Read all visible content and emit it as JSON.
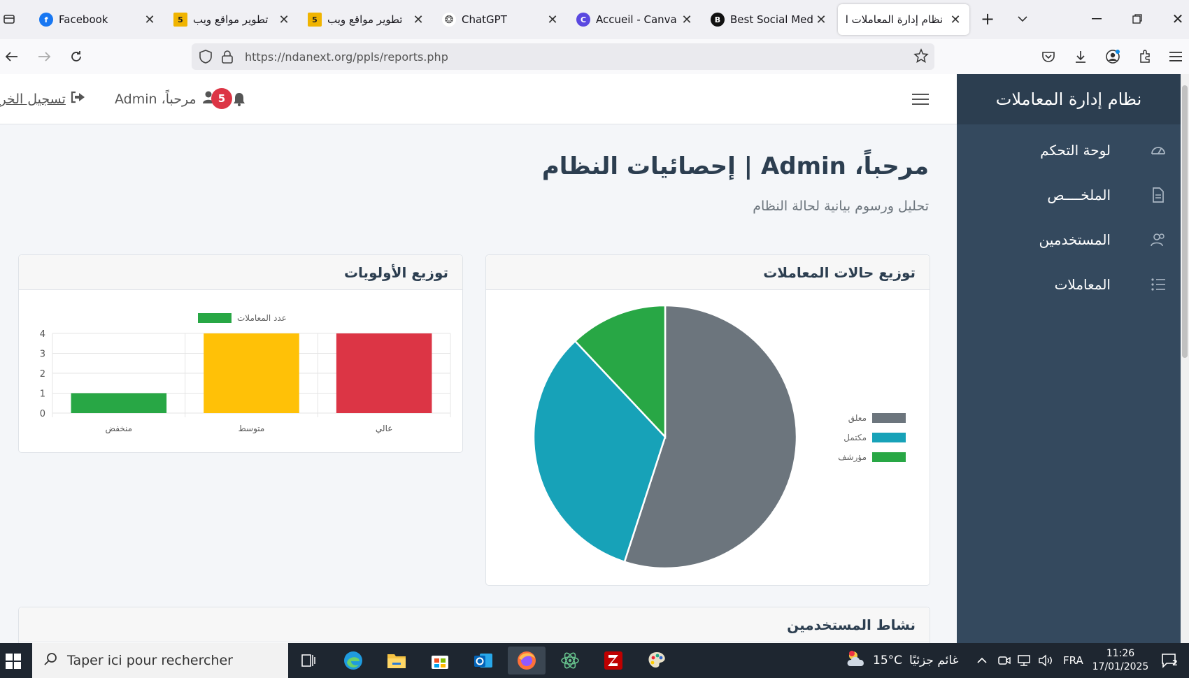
{
  "browser": {
    "tabs": [
      {
        "label": "Facebook",
        "favicon_color": "#1877f2",
        "favicon_text": "f"
      },
      {
        "label": "تطوير مواقع ويب",
        "favicon_color": "#f0b400",
        "favicon_text": "5"
      },
      {
        "label": "تطوير مواقع ويب",
        "favicon_color": "#f0b400",
        "favicon_text": "5"
      },
      {
        "label": "ChatGPT",
        "favicon_color": "#444444",
        "favicon_text": "◎"
      },
      {
        "label": "Accueil - Canva",
        "favicon_color": "#5a48e0",
        "favicon_text": "C"
      },
      {
        "label": "Best Social Media",
        "favicon_color": "#111111",
        "favicon_text": "B"
      },
      {
        "label": "نظام إدارة المعاملات ال",
        "favicon_color": "#ffffff",
        "favicon_text": "",
        "active": true
      }
    ],
    "url": "https://ndanext.org/ppls/reports.php"
  },
  "app": {
    "brand": "نظام إدارة المعاملات",
    "sidebar": [
      {
        "label": "لوحة التحكم",
        "icon": "dashboard-icon"
      },
      {
        "label": "الملخــــص",
        "icon": "document-icon"
      },
      {
        "label": "المستخدمين",
        "icon": "users-icon"
      },
      {
        "label": "المعاملات",
        "icon": "list-icon"
      }
    ],
    "topbar": {
      "logout_label": "تسجيل الخروج",
      "welcome_label": "مرحباً، Admin",
      "notification_count": "5"
    },
    "page_title": "مرحباً، Admin | إحصائيات النظام",
    "page_subtitle": "تحليل ورسوم بيانية لحالة النظام",
    "cards": {
      "status_title": "توزيع حالات المعاملات",
      "priority_title": "توزيع الأولويات",
      "activity_title": "نشاط المستخدمين"
    }
  },
  "chart_data": [
    {
      "type": "pie",
      "title": "توزيع حالات المعاملات",
      "series": [
        {
          "name": "معلق",
          "value": 55,
          "color": "#6c757d"
        },
        {
          "name": "مكتمل",
          "value": 33,
          "color": "#17a2b8"
        },
        {
          "name": "مؤرشف",
          "value": 12,
          "color": "#28a745"
        }
      ],
      "legend_position": "right"
    },
    {
      "type": "bar",
      "title": "توزيع الأولويات",
      "categories": [
        "منخفض",
        "متوسط",
        "عالي"
      ],
      "values": [
        1,
        4,
        4
      ],
      "colors": [
        "#28a745",
        "#ffc107",
        "#dc3545"
      ],
      "series_name": "عدد المعاملات",
      "ylim": [
        0,
        4
      ],
      "yticks": [
        0,
        1,
        2,
        3,
        4
      ],
      "grid": true,
      "legend_position": "top"
    }
  ],
  "taskbar": {
    "search_placeholder": "Taper ici pour rechercher",
    "weather_temp": "15°C",
    "weather_desc": "غائم جزئيًا",
    "language": "FRA",
    "time": "11:26",
    "date": "17/01/2025",
    "notification_badge": "2"
  }
}
